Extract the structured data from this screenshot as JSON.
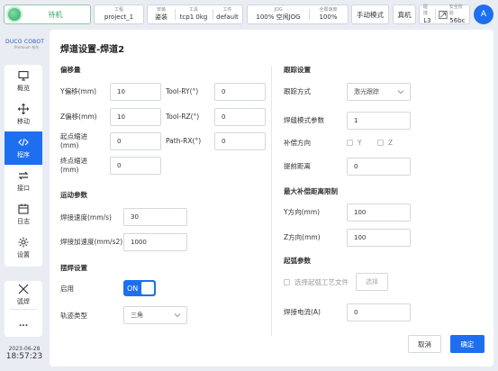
{
  "topbar": {
    "status": "待机",
    "group1": [
      {
        "label": "工程",
        "value": "project_1"
      }
    ],
    "group2": [
      {
        "label": "安装",
        "value": "姿装"
      },
      {
        "label": "工具",
        "value": "tcp1    0kg"
      },
      {
        "label": "工件",
        "value": "default"
      }
    ],
    "group3": [
      {
        "label": "JOG",
        "value": "100%  空闲JOG"
      },
      {
        "label": "全局速度",
        "value": "100%"
      }
    ],
    "mode_button": "手动模式",
    "real_button": "真机",
    "collision": {
      "label": "碰撞",
      "value": "L3"
    },
    "safety": {
      "label": "安全校验",
      "value": "56bc"
    },
    "avatar": "A"
  },
  "sidebar": {
    "logo": "DUCO COBOT",
    "logo_sub": "Premium 系列",
    "items": [
      {
        "label": "概览",
        "icon": "monitor-icon"
      },
      {
        "label": "移动",
        "icon": "move-arrows-icon"
      },
      {
        "label": "程序",
        "icon": "code-icon"
      },
      {
        "label": "接口",
        "icon": "transfer-icon"
      },
      {
        "label": "日志",
        "icon": "calendar-icon"
      },
      {
        "label": "设置",
        "icon": "gear-icon"
      }
    ],
    "extra": [
      {
        "label": "弧焊",
        "icon": "welding-torch-icon"
      },
      {
        "label": "...",
        "icon": "more-icon"
      }
    ],
    "date": "2023-06-28",
    "time": "18:57:23"
  },
  "dialog": {
    "title": "焊道设置-焊道2",
    "offset": {
      "section": "偏移量",
      "y_label": "Y偏移(mm)",
      "y_value": "10",
      "z_label": "Z偏移(mm)",
      "z_value": "10",
      "start_label": "起点缩进\n(mm)",
      "start_value": "0",
      "end_label": "终点缩进\n(mm)",
      "end_value": "0",
      "ry_label": "Tool-RY(°)",
      "ry_value": "0",
      "rz_label": "Tool-RZ(°)",
      "rz_value": "0",
      "rx_label": "Path-RX(°)",
      "rx_value": "0"
    },
    "motion": {
      "section": "运动参数",
      "speed_label": "焊接速度(mm/s)",
      "speed_value": "30",
      "acc_label": "焊接加速度(mm/s2)",
      "acc_value": "1000"
    },
    "weave": {
      "section": "摆焊设置",
      "enable_label": "启用",
      "enable_value": "ON",
      "track_label": "轨迹类型",
      "track_value": "三角"
    },
    "tracking": {
      "section": "跟踪设置",
      "mode_label": "跟踪方式",
      "mode_value": "激光跟踪",
      "param_label": "焊缝模式参数",
      "param_value": "1",
      "comp_label": "补偿方向",
      "comp_y": "Y",
      "comp_z": "Z",
      "advance_label": "提前距离",
      "advance_value": "0"
    },
    "limit": {
      "section": "最大补偿距离限制",
      "y_label": "Y方向(mm)",
      "y_value": "100",
      "z_label": "Z方向(mm)",
      "z_value": "100"
    },
    "arc": {
      "section": "起弧参数",
      "file_label": "选择起弧工艺文件",
      "file_button": "选择",
      "current_label": "焊接电流(A)",
      "current_value": "0"
    },
    "cancel": "取消",
    "ok": "确定"
  }
}
